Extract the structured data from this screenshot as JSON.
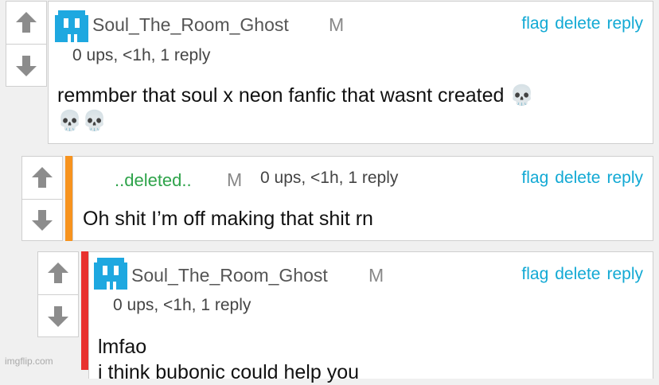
{
  "comments": [
    {
      "username": "Soul_The_Room_Ghost",
      "mod_badge": "M",
      "meta": "0 ups, <1h, 1 reply",
      "actions": {
        "flag": "flag",
        "delete": "delete",
        "reply": "reply"
      },
      "body": "remmber that soul x neon fanfic that wasnt created 💀\n💀💀"
    },
    {
      "username": "..deleted..",
      "mod_badge": "M",
      "meta": "0 ups, <1h, 1 reply",
      "actions": {
        "flag": "flag",
        "delete": "delete",
        "reply": "reply"
      },
      "body": "Oh shit I’m off making that shit rn",
      "thread_color": "#f7931e"
    },
    {
      "username": "Soul_The_Room_Ghost",
      "mod_badge": "M",
      "meta": "0 ups, <1h, 1 reply",
      "actions": {
        "flag": "flag",
        "delete": "delete",
        "reply": "reply"
      },
      "body_line1": "lmfao",
      "body_line2": "i think bubonic could help you",
      "thread_color": "#e8322f"
    }
  ],
  "icons": {
    "upvote": "up-arrow-icon",
    "downvote": "down-arrow-icon",
    "avatar": "ghost-avatar-icon"
  },
  "colors": {
    "link": "#12a9d4",
    "deleted_name": "#2ea34a",
    "vote_arrow": "#8c8c8c"
  },
  "watermark": "imgflip.com"
}
